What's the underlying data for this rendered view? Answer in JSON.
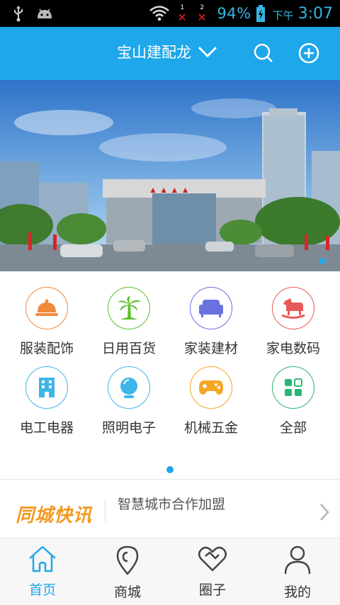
{
  "status_bar": {
    "sim1": "1",
    "sim2": "2",
    "battery_percent": "94%",
    "ampm": "下午",
    "time": "3:07"
  },
  "header": {
    "title": "宝山建配龙",
    "accent_color": "#1ea7ea"
  },
  "banner": {
    "slide_count": 1
  },
  "categories": [
    {
      "label": "服装配饰",
      "icon": "cloche-icon",
      "color": "#f08a3c"
    },
    {
      "label": "日用百货",
      "icon": "palm-tree-icon",
      "color": "#5cbf2a"
    },
    {
      "label": "家装建材",
      "icon": "sofa-icon",
      "color": "#6a72e0"
    },
    {
      "label": "家电数码",
      "icon": "rocking-horse-icon",
      "color": "#e85a5a"
    },
    {
      "label": "电工电器",
      "icon": "building-icon",
      "color": "#3fb5e8"
    },
    {
      "label": "照明电子",
      "icon": "globe-lamp-icon",
      "color": "#3fb5e8"
    },
    {
      "label": "机械五金",
      "icon": "gamepad-icon",
      "color": "#f5a623"
    },
    {
      "label": "全部",
      "icon": "grid-icon",
      "color": "#2bb673"
    }
  ],
  "news": {
    "logo": "同城快讯",
    "headline": "智慧城市合作加盟"
  },
  "tabs": [
    {
      "label": "首页",
      "icon": "home-icon",
      "active": true
    },
    {
      "label": "商城",
      "icon": "map-pin-icon",
      "active": false
    },
    {
      "label": "圈子",
      "icon": "heart-icon",
      "active": false
    },
    {
      "label": "我的",
      "icon": "user-icon",
      "active": false
    }
  ]
}
